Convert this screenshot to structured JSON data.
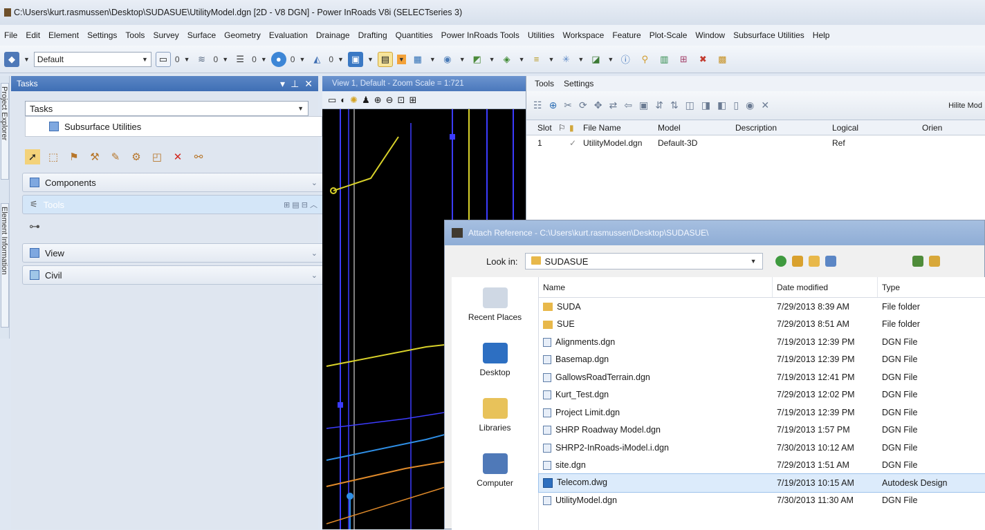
{
  "window": {
    "title": "C:\\Users\\kurt.rasmussen\\Desktop\\SUDASUE\\UtilityModel.dgn [2D - V8 DGN] - Power InRoads V8i (SELECTseries 3)"
  },
  "menu": [
    "File",
    "Edit",
    "Element",
    "Settings",
    "Tools",
    "Survey",
    "Surface",
    "Geometry",
    "Evaluation",
    "Drainage",
    "Drafting",
    "Quantities",
    "Power InRoads Tools",
    "Utilities",
    "Workspace",
    "Feature",
    "Plot-Scale",
    "Window",
    "Subsurface Utilities",
    "Help"
  ],
  "toolbar": {
    "level": "Default",
    "counts": [
      "0",
      "0",
      "0",
      "0",
      "0"
    ]
  },
  "left_tabs": {
    "project_explorer": "Project Explorer",
    "element_information": "Element Information"
  },
  "tasks": {
    "panel_title": "Tasks",
    "combo": "Tasks",
    "selected_item": "Subsurface Utilities",
    "sections": [
      "Components",
      "Tools",
      "View",
      "Civil"
    ]
  },
  "view": {
    "title": "View 1, Default - Zoom Scale = 1:721"
  },
  "references": {
    "menu": [
      "Tools",
      "Settings"
    ],
    "hilite": "Hilite Mod",
    "columns": [
      "Slot",
      "File Name",
      "Model",
      "Description",
      "Logical",
      "Orien"
    ],
    "rows": [
      {
        "slot": "1",
        "file": "UtilityModel.dgn",
        "model": "Default-3D",
        "description": "",
        "logical": "Ref"
      }
    ]
  },
  "dialog": {
    "title": "Attach Reference - C:\\Users\\kurt.rasmussen\\Desktop\\SUDASUE\\",
    "look_in_label": "Look in:",
    "look_in_value": "SUDASUE",
    "places": [
      "Recent Places",
      "Desktop",
      "Libraries",
      "Computer"
    ],
    "columns": [
      "Name",
      "Date modified",
      "Type"
    ],
    "files": [
      {
        "name": "SUDA",
        "date": "7/29/2013 8:39 AM",
        "type": "File folder",
        "kind": "folder"
      },
      {
        "name": "SUE",
        "date": "7/29/2013 8:51 AM",
        "type": "File folder",
        "kind": "folder"
      },
      {
        "name": "Alignments.dgn",
        "date": "7/19/2013 12:39 PM",
        "type": "DGN File",
        "kind": "dgn"
      },
      {
        "name": "Basemap.dgn",
        "date": "7/19/2013 12:39 PM",
        "type": "DGN File",
        "kind": "dgn"
      },
      {
        "name": "GallowsRoadTerrain.dgn",
        "date": "7/19/2013 12:41 PM",
        "type": "DGN File",
        "kind": "dgn"
      },
      {
        "name": "Kurt_Test.dgn",
        "date": "7/29/2013 12:02 PM",
        "type": "DGN File",
        "kind": "dgn"
      },
      {
        "name": "Project Limit.dgn",
        "date": "7/19/2013 12:39 PM",
        "type": "DGN File",
        "kind": "dgn"
      },
      {
        "name": "SHRP Roadway Model.dgn",
        "date": "7/19/2013 1:57 PM",
        "type": "DGN File",
        "kind": "dgn"
      },
      {
        "name": "SHRP2-InRoads-iModel.i.dgn",
        "date": "7/30/2013 10:12 AM",
        "type": "DGN File",
        "kind": "dgn"
      },
      {
        "name": "site.dgn",
        "date": "7/29/2013 1:51 AM",
        "type": "DGN File",
        "kind": "dgn"
      },
      {
        "name": "Telecom.dwg",
        "date": "7/19/2013 10:15 AM",
        "type": "Autodesk Design",
        "kind": "dwg",
        "selected": true
      },
      {
        "name": "UtilityModel.dgn",
        "date": "7/30/2013 11:30 AM",
        "type": "DGN File",
        "kind": "dgn"
      }
    ]
  }
}
